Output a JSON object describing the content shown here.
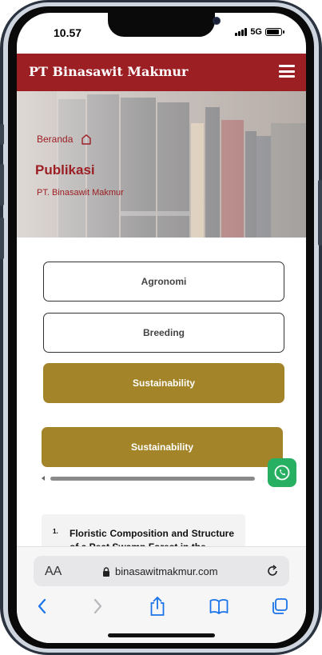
{
  "status_bar": {
    "time": "10.57",
    "network": "5G",
    "battery_level": 0.9
  },
  "header": {
    "brand": "PT  Binasawit Makmur",
    "menu_icon": "hamburger-icon",
    "bg_color": "#9c1f24"
  },
  "hero": {
    "breadcrumb": "Beranda",
    "title": "Publikasi",
    "subtitle": "PT. Binasawit Makmur"
  },
  "filters": [
    {
      "label": "Agronomi",
      "active": false
    },
    {
      "label": "Breeding",
      "active": false
    },
    {
      "label": "Sustainability",
      "active": true
    }
  ],
  "selected_category": "Sustainability",
  "accent_color": "#a48428",
  "whatsapp_icon": "whatsapp-icon",
  "publications": [
    {
      "number": "1.",
      "title": "Floristic Composition and Structure of a Peat Swamp Forest in the"
    }
  ],
  "safari": {
    "text_size_label": "AA",
    "url": "binasawitmakmur.com",
    "icons": [
      "back-icon",
      "forward-icon",
      "share-icon",
      "bookmarks-icon",
      "tabs-icon"
    ]
  }
}
